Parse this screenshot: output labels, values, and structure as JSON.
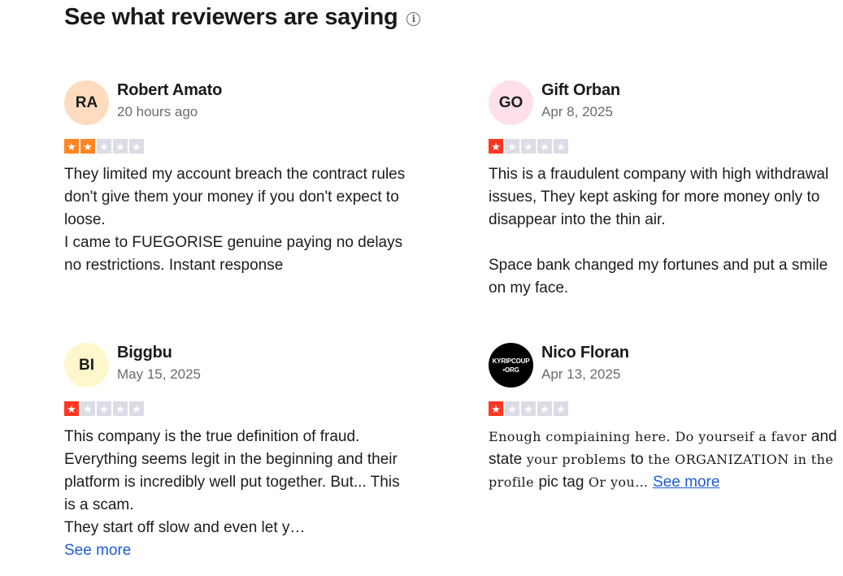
{
  "section": {
    "title": "See what reviewers are saying",
    "info_icon": "info-icon"
  },
  "reviews": [
    {
      "initials": "RA",
      "avatar_color": "#ffdcbf",
      "name": "Robert Amato",
      "date": "20 hours ago",
      "rating": 2,
      "star_color": "#ff8622",
      "text": "They limited my account breach the contract rules don't give them your money if you don't expect to loose.\nI came to FUEGORISE genuine paying no delays no restrictions. Instant response"
    },
    {
      "initials": "GO",
      "avatar_color": "#ffe0ea",
      "name": "Gift Orban",
      "date": "Apr 8, 2025",
      "rating": 1,
      "star_color": "#ff3722",
      "text": "This is a fraudulent company with high withdrawal issues, They kept asking for more money only to disappear into the thin air.\n\nSpace bank changed my fortunes and put a smile on my face."
    },
    {
      "initials": "BI",
      "avatar_color": "#fff7cc",
      "name": "Biggbu",
      "date": "May 15, 2025",
      "rating": 1,
      "star_color": "#ff3722",
      "text": "This company is the true definition of fraud. Everything seems legit in the beginning and their platform is incredibly well put together. But... This is a scam.\nThey start off slow and even let y…",
      "see_more": "See more"
    },
    {
      "avatar_logo_line1": "KYRIPCOUP",
      "avatar_logo_line2": "•ORG",
      "avatar_color": "#000000",
      "name": "Nico Floran",
      "date": "Apr 13, 2025",
      "rating": 1,
      "star_color": "#ff3722",
      "text_parts": [
        "Enough compiaining here. Do yourseif a favor ",
        "and state",
        " your problems ",
        "to",
        " the ORGANIZATION in the profile ",
        "pic tag",
        " Or you… "
      ],
      "see_more": "See more"
    }
  ],
  "star_empty_color": "#dcdce6",
  "link_color": "#1e5bd6"
}
